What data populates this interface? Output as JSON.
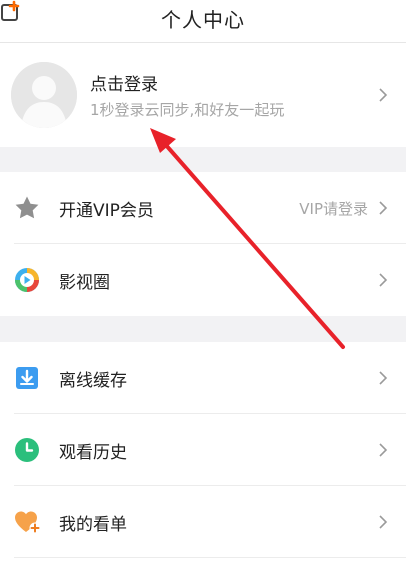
{
  "header": {
    "title": "个人中心"
  },
  "profile": {
    "name": "点击登录",
    "subtitle": "1秒登录云同步,和好友一起玩"
  },
  "menu": [
    {
      "label": "开通VIP会员",
      "right": "VIP请登录",
      "icon": "star-icon"
    },
    {
      "label": "影视圈",
      "icon": "play-circle-icon"
    },
    {
      "label": "离线缓存",
      "icon": "download-icon"
    },
    {
      "label": "观看历史",
      "icon": "clock-icon"
    },
    {
      "label": "我的看单",
      "icon": "heart-plus-icon"
    }
  ],
  "colors": {
    "accent": "#ff6a00",
    "arrow": "#e8222a",
    "download_blue": "#3c9cf0",
    "history_green": "#2bbf7c",
    "heart_orange": "#f6a24a"
  }
}
